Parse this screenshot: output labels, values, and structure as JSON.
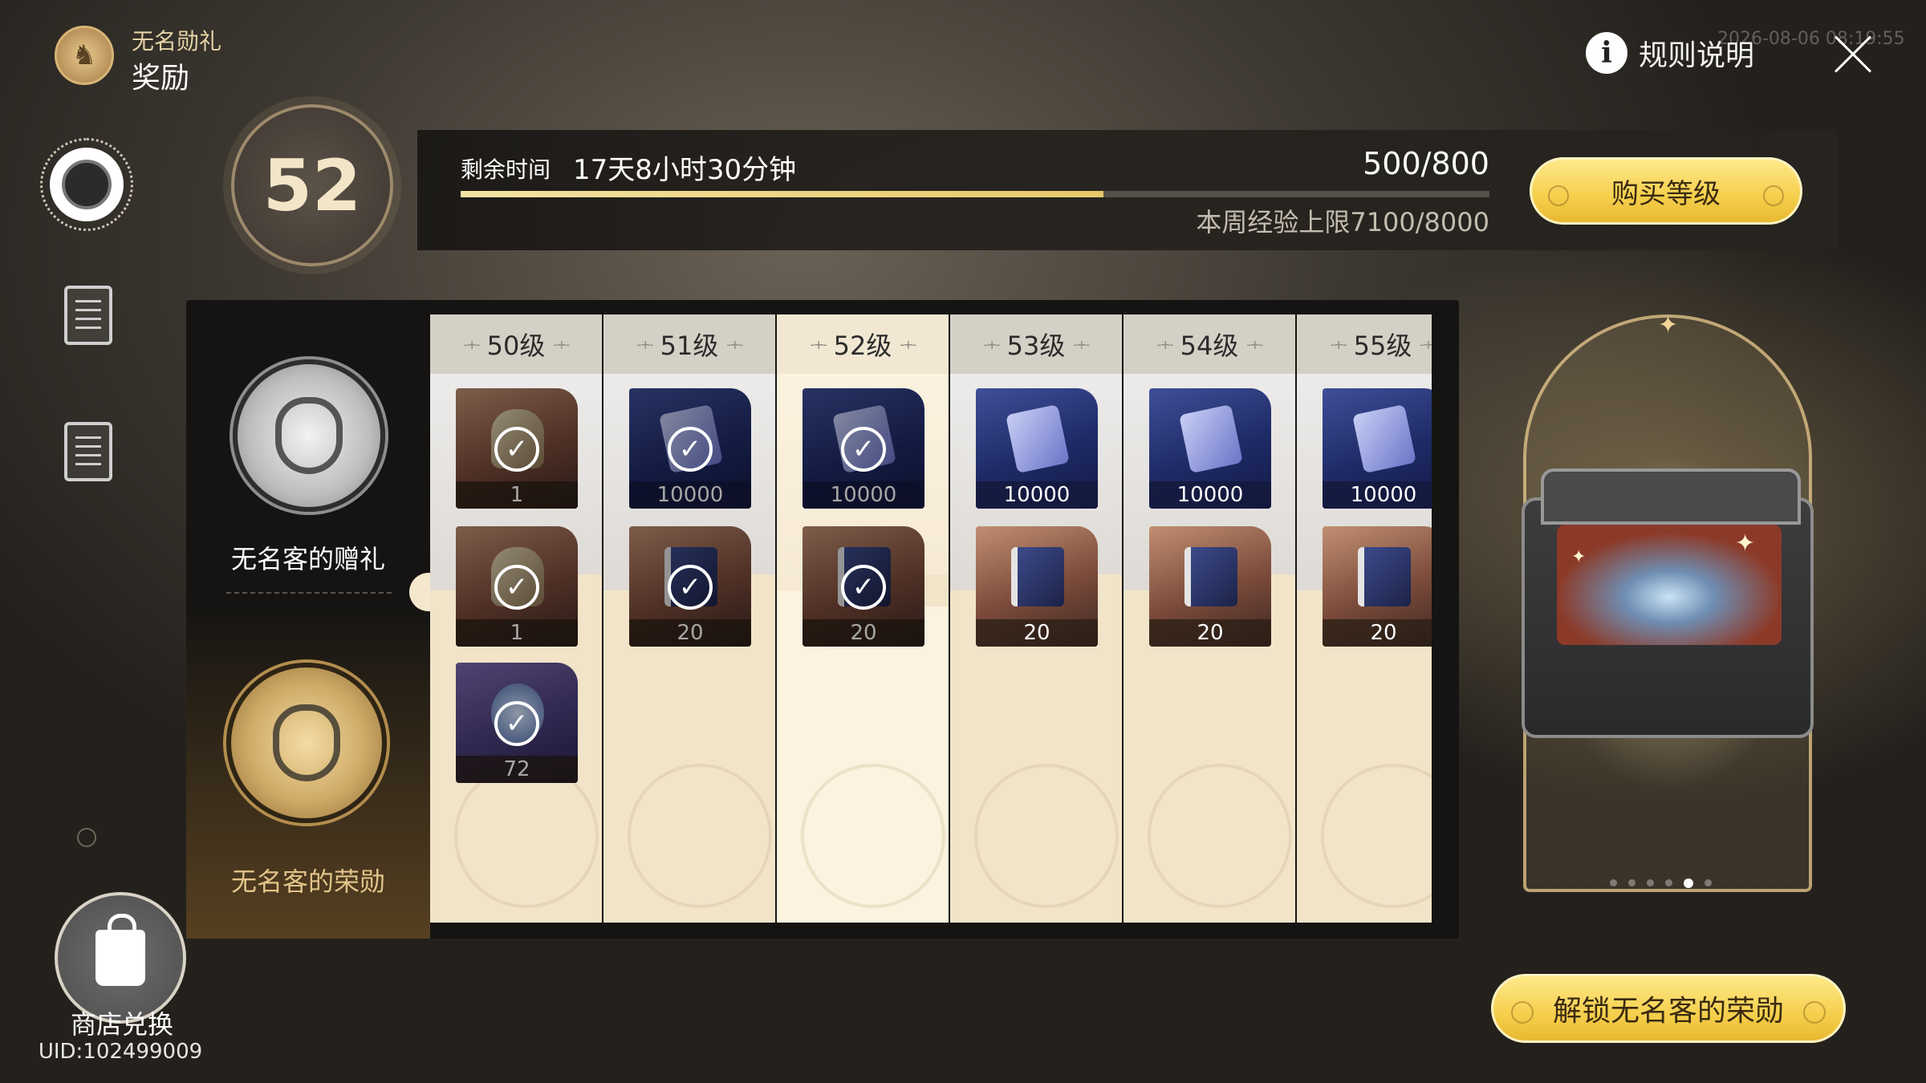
{
  "header": {
    "subtitle": "无名勋礼",
    "title": "奖励",
    "rules_label": "规则说明",
    "timestamp": "2026-08-06 08:19:55"
  },
  "level": {
    "current": "52",
    "time_label": "剩余时间",
    "time_value": "17天8小时30分钟",
    "exp_text": "500/800",
    "exp_progress": 0.625,
    "weekly_cap": "本周经验上限7100/8000",
    "buy_label": "购买等级"
  },
  "tracks": {
    "free_label": "无名客的赠礼",
    "paid_label": "无名客的荣勋"
  },
  "columns": [
    {
      "level": "50级",
      "free": {
        "qty": "1",
        "style": "brown",
        "claimed": true
      },
      "paid": [
        {
          "qty": "1",
          "style": "brown",
          "claimed": true
        },
        {
          "qty": "72",
          "style": "purple",
          "claimed": true
        }
      ]
    },
    {
      "level": "51级",
      "free": {
        "qty": "10000",
        "style": "blue",
        "claimed": true
      },
      "paid": [
        {
          "qty": "20",
          "style": "brown",
          "claimed": true
        }
      ]
    },
    {
      "level": "52级",
      "free": {
        "qty": "10000",
        "style": "blue",
        "claimed": true
      },
      "paid": [
        {
          "qty": "20",
          "style": "brown",
          "claimed": true
        }
      ],
      "current": true
    },
    {
      "level": "53级",
      "free": {
        "qty": "10000",
        "style": "blue",
        "claimed": false
      },
      "paid": [
        {
          "qty": "20",
          "style": "brown",
          "claimed": false
        }
      ]
    },
    {
      "level": "54级",
      "free": {
        "qty": "10000",
        "style": "blue",
        "claimed": false
      },
      "paid": [
        {
          "qty": "20",
          "style": "brown",
          "claimed": false
        }
      ]
    },
    {
      "level": "55级",
      "free": {
        "qty": "10000",
        "style": "blue",
        "claimed": false
      },
      "paid": [
        {
          "qty": "20",
          "style": "brown",
          "claimed": false
        }
      ]
    }
  ],
  "showcase": {
    "pages": 6,
    "active_page": 5
  },
  "unlock_label": "解锁无名客的荣勋",
  "shop": {
    "label": "商店兑换",
    "uid": "UID:102499009"
  },
  "colors": {
    "accent_gold": "#f5cf4c",
    "exp_fill": "#e8c86a"
  }
}
